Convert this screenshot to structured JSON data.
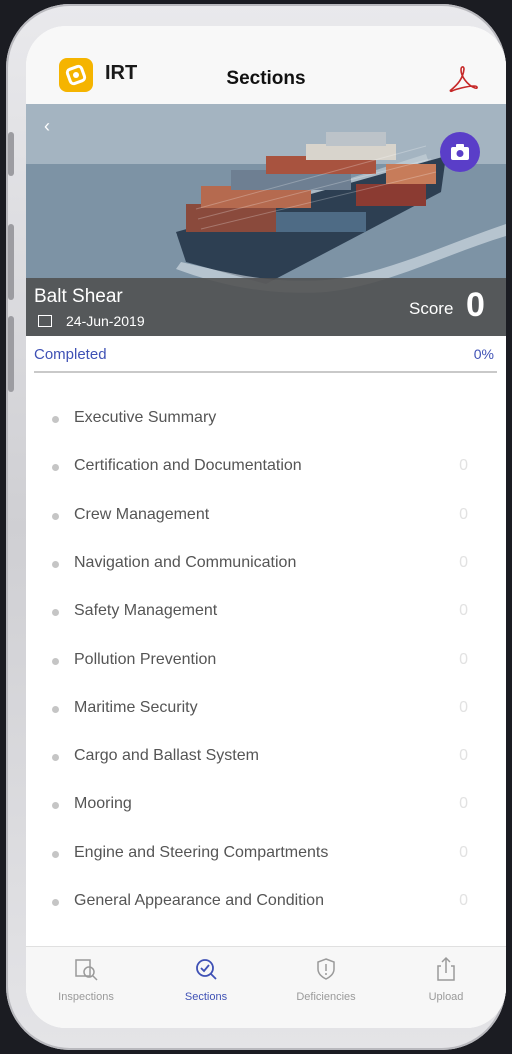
{
  "header": {
    "brand": "IRT",
    "title": "Sections"
  },
  "hero": {
    "vessel_name": "Balt Shear",
    "date": "24-Jun-2019",
    "score_label": "Score",
    "score_value": "0"
  },
  "progress": {
    "label": "Completed",
    "percent": "0%",
    "fraction": 0
  },
  "sections": [
    {
      "label": "Executive Summary",
      "count": ""
    },
    {
      "label": "Certification and Documentation",
      "count": "0"
    },
    {
      "label": "Crew Management",
      "count": "0"
    },
    {
      "label": "Navigation and Communication",
      "count": "0"
    },
    {
      "label": "Safety Management",
      "count": "0"
    },
    {
      "label": "Pollution Prevention",
      "count": "0"
    },
    {
      "label": "Maritime Security",
      "count": "0"
    },
    {
      "label": "Cargo and Ballast System",
      "count": "0"
    },
    {
      "label": "Mooring",
      "count": "0"
    },
    {
      "label": "Engine and Steering Compartments",
      "count": "0"
    },
    {
      "label": "General  Appearance and Condition",
      "count": "0"
    }
  ],
  "tabs": [
    {
      "label": "Inspections",
      "icon": "inspections-icon",
      "active": false
    },
    {
      "label": "Sections",
      "icon": "sections-icon",
      "active": true
    },
    {
      "label": "Deficiencies",
      "icon": "deficiencies-icon",
      "active": false
    },
    {
      "label": "Upload",
      "icon": "upload-icon",
      "active": false
    }
  ],
  "colors": {
    "accent": "#3f51b5",
    "logo": "#f5b400",
    "camera_button": "#5a3ec8"
  }
}
